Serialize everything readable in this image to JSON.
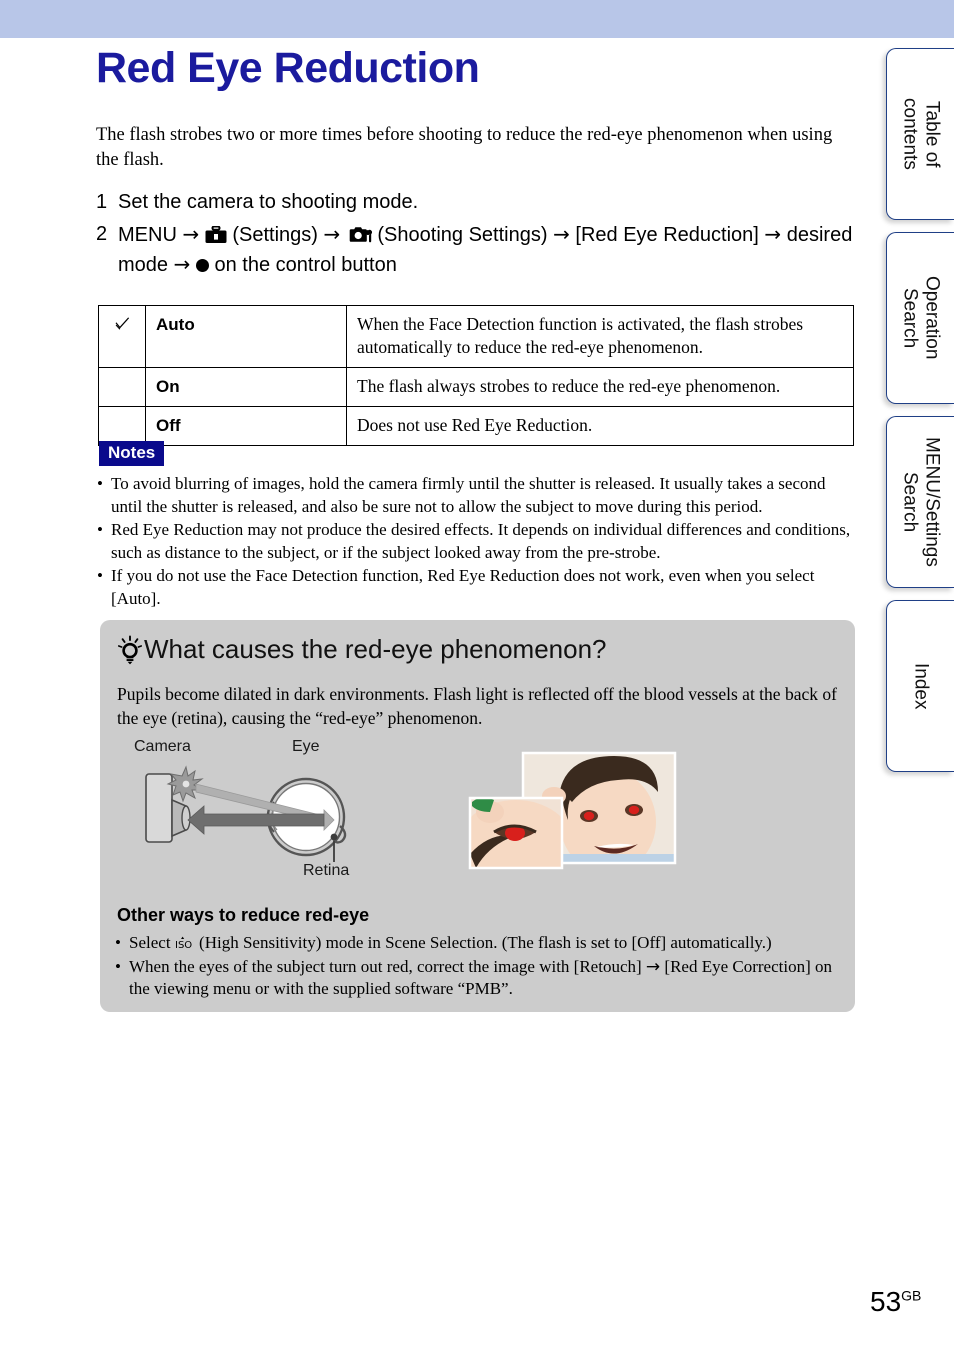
{
  "header": {
    "band_color": "#b8c6e8"
  },
  "title": "Red Eye Reduction",
  "title_color": "#1b1b9e",
  "intro": "The flash strobes two or more times before shooting to reduce the red-eye phenomenon when using the flash.",
  "steps": [
    {
      "num": "1",
      "text": "Set the camera to shooting mode."
    },
    {
      "num": "2",
      "part1": "MENU",
      "arrow1": "→",
      "icon1": "toolbox-icon",
      "label1": "(Settings)",
      "arrow2": "→",
      "icon2": "camera-wrench-icon",
      "label2": "(Shooting Settings)",
      "arrow3": "→",
      "part2": "[Red Eye Reduction]",
      "arrow4": "→",
      "part3": "desired mode",
      "arrow5": "→",
      "icon3": "control-button-dot-icon",
      "part4": "on the control button"
    }
  ],
  "options_table": {
    "rows": [
      {
        "check": "✓",
        "checked": true,
        "name": "Auto",
        "description": "When the Face Detection function is activated, the flash strobes automatically to reduce the red-eye phenomenon."
      },
      {
        "check": "",
        "checked": false,
        "name": "On",
        "description": "The flash always strobes to reduce the red-eye phenomenon."
      },
      {
        "check": "",
        "checked": false,
        "name": "Off",
        "description": "Does not use Red Eye Reduction."
      }
    ]
  },
  "notes": {
    "badge": "Notes",
    "badge_bg": "#0a0a8c",
    "items": [
      "To avoid blurring of images, hold the camera firmly until the shutter is released. It usually takes a second until the shutter is released, and also be sure not to allow the subject to move during this period.",
      "Red Eye Reduction may not produce the desired effects. It depends on individual differences and conditions, such as distance to the subject, or if the subject looked away from the pre-strobe.",
      "If you do not use the Face Detection function, Red Eye Reduction does not work, even when you select [Auto]."
    ]
  },
  "tip_box": {
    "bg_color": "#cccccc",
    "icon": "lightbulb-icon",
    "heading": "What causes the red-eye phenomenon?",
    "body": "Pupils become dilated in dark environments. Flash light is reflected off the blood vessels at the back of the eye (retina), causing the “red-eye” phenomenon.",
    "diagram": {
      "label_camera": "Camera",
      "label_eye": "Eye",
      "label_retina": "Retina"
    },
    "other_ways": {
      "heading": "Other ways to reduce red-eye",
      "item1_pre": "Select",
      "item1_icon": "iso-high-sensitivity-icon",
      "item1_post": "(High Sensitivity) mode in Scene Selection. (The flash is set to [Off] automatically.)",
      "item2_pre": "When the eyes of the subject turn out red, correct the image with [Retouch]",
      "item2_arrow": "→",
      "item2_post": "[Red Eye Correction] on the viewing menu or with the supplied software “PMB”."
    }
  },
  "side_tabs": [
    {
      "label": "Table of\ncontents"
    },
    {
      "label": "Operation\nSearch"
    },
    {
      "label": "MENU/Settings\nSearch"
    },
    {
      "label": "Index"
    }
  ],
  "page_number": {
    "number": "53",
    "suffix": "GB"
  }
}
